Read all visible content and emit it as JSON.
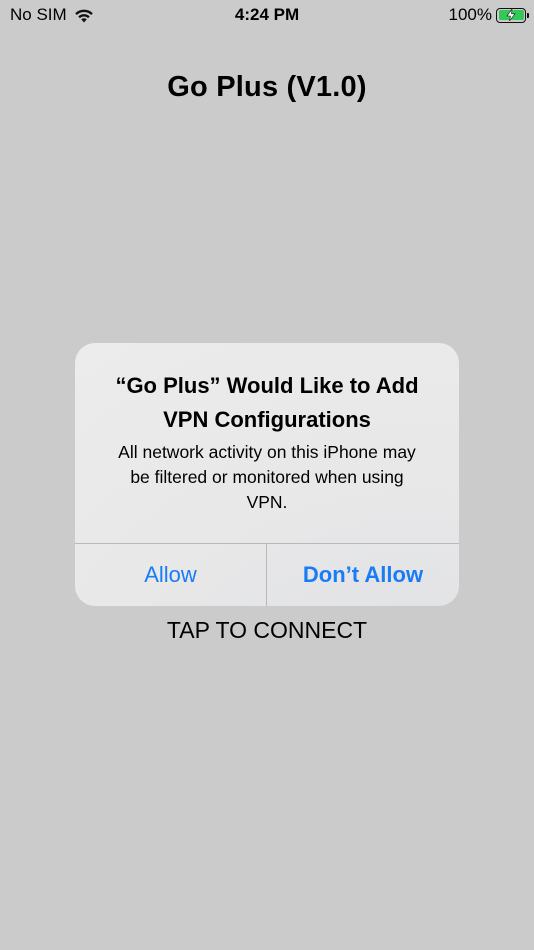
{
  "status_bar": {
    "carrier": "No SIM",
    "time": "4:24 PM",
    "battery_percent": "100%",
    "icons": [
      "wifi-icon",
      "battery-icon",
      "charging-bolt-icon"
    ],
    "battery_color": "#34c759"
  },
  "app": {
    "title": "Go Plus (V1.0)",
    "connect_label": "TAP TO CONNECT"
  },
  "alert": {
    "title_line1": "“Go Plus” Would Like to Add",
    "title_line2": "VPN Configurations",
    "message_line1": "All network activity on this iPhone may",
    "message_line2": "be filtered or monitored when using",
    "message_line3": "VPN.",
    "allow_label": "Allow",
    "dont_allow_label": "Don’t Allow",
    "button_color": "#1a7cf5"
  }
}
